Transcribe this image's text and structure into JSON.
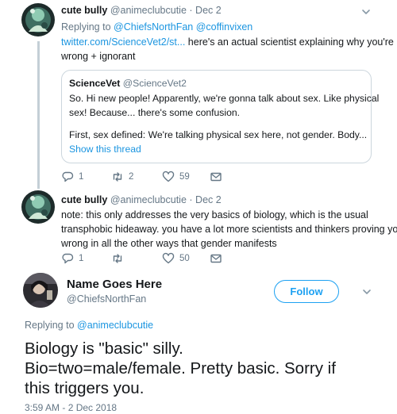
{
  "tweet1": {
    "name": "cute bully",
    "handle": "@animeclubcutie",
    "sep": "·",
    "date": "Dec 2",
    "replying_prefix": "Replying to",
    "replying_to": "@ChiefsNorthFan @coffinvixen",
    "link_text": "twitter.com/ScienceVet2/st...",
    "text_rest": " here's an actual scientist explaining why you're",
    "text_line2": "wrong + ignorant",
    "quote": {
      "name": "ScienceVet",
      "handle": "@ScienceVet2",
      "line1": "So. Hi new people! Apparently, we're gonna talk about sex. Like physical",
      "line2": "sex! Because... there's some confusion.",
      "line3": "First, sex defined: We're talking physical sex here, not gender. Body...",
      "show_thread": "Show this thread"
    },
    "replies": "1",
    "retweets": "2",
    "likes": "59"
  },
  "tweet2": {
    "name": "cute bully",
    "handle": "@animeclubcutie",
    "sep": "·",
    "date": "Dec 2",
    "line1": "note: this only addresses the very basics of biology, which is the usual",
    "line2": "transphobic hideaway. you have a lot more scientists and thinkers proving you",
    "line3": "wrong in all the other ways that gender manifests",
    "replies": "1",
    "retweets": "",
    "likes": "50"
  },
  "main": {
    "name": "Name Goes Here",
    "handle": "@ChiefsNorthFan",
    "follow_label": "Follow",
    "replying_prefix": "Replying to",
    "replying_to": "@animeclubcutie",
    "line1": "Biology is \"basic\" silly.",
    "line2": "Bio=two=male/female. Pretty basic. Sorry if",
    "line3": "this triggers you.",
    "timestamp": "3:59 AM - 2 Dec 2018"
  },
  "colors": {
    "link": "#1b95e0",
    "follow": "#1da1f2",
    "muted": "#657786",
    "thread_line": "#c4cfd6"
  }
}
